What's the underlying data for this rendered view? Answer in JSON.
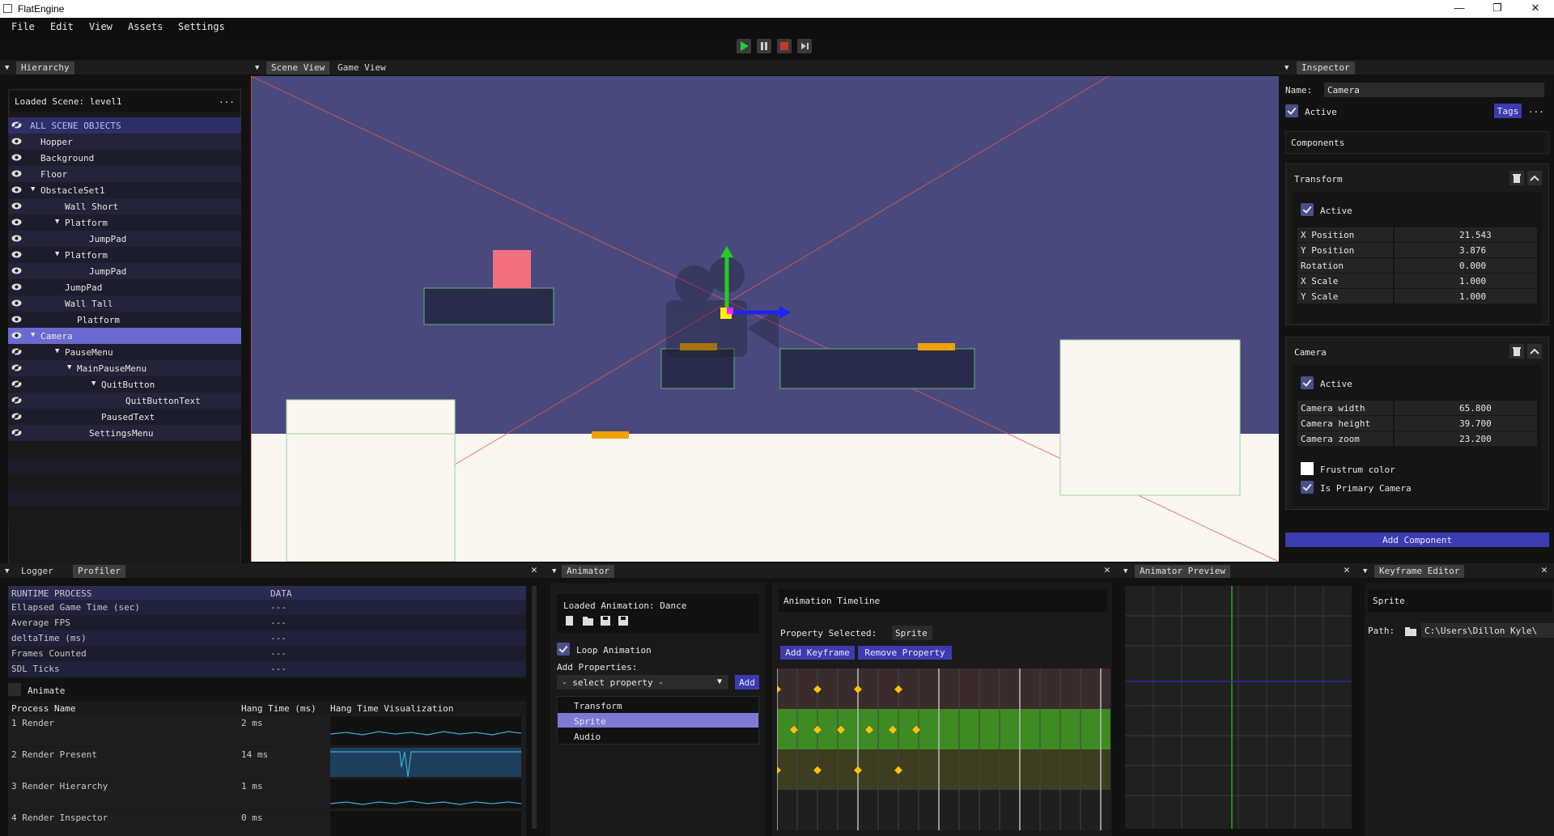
{
  "window": {
    "title": "FlatEngine",
    "minimize": "—",
    "restore": "❐",
    "close": "✕"
  },
  "menu": [
    "File",
    "Edit",
    "View",
    "Assets",
    "Settings"
  ],
  "hierarchy": {
    "tab": "Hierarchy",
    "loaded_scene": "Loaded Scene: level1",
    "more": "...",
    "all_objects": "ALL SCENE OBJECTS",
    "items": [
      {
        "label": "Hopper",
        "indent": 0,
        "arrow": ""
      },
      {
        "label": "Background",
        "indent": 0,
        "arrow": ""
      },
      {
        "label": "Floor",
        "indent": 0,
        "arrow": ""
      },
      {
        "label": "ObstacleSet1",
        "indent": 0,
        "arrow": "▼"
      },
      {
        "label": "Wall Short",
        "indent": 2,
        "arrow": ""
      },
      {
        "label": "Platform",
        "indent": 2,
        "arrow": "▼"
      },
      {
        "label": "JumpPad",
        "indent": 4,
        "arrow": ""
      },
      {
        "label": "Platform",
        "indent": 2,
        "arrow": "▼"
      },
      {
        "label": "JumpPad",
        "indent": 4,
        "arrow": ""
      },
      {
        "label": "JumpPad",
        "indent": 2,
        "arrow": ""
      },
      {
        "label": "Wall Tall",
        "indent": 2,
        "arrow": ""
      },
      {
        "label": "Platform",
        "indent": 3,
        "arrow": ""
      },
      {
        "label": "Camera",
        "indent": 0,
        "arrow": "▼"
      },
      {
        "label": "PauseMenu",
        "indent": 2,
        "arrow": "▼"
      },
      {
        "label": "MainPauseMenu",
        "indent": 3,
        "arrow": "▼"
      },
      {
        "label": "QuitButton",
        "indent": 5,
        "arrow": "▼"
      },
      {
        "label": "QuitButtonText",
        "indent": 7,
        "arrow": ""
      },
      {
        "label": "PausedText",
        "indent": 5,
        "arrow": ""
      },
      {
        "label": "SettingsMenu",
        "indent": 4,
        "arrow": ""
      }
    ]
  },
  "scene_tabs": [
    "Scene View",
    "Game View"
  ],
  "inspector": {
    "tab": "Inspector",
    "name_label": "Name:",
    "name_value": "Camera",
    "active": "Active",
    "tags": "Tags",
    "more": "...",
    "components": "Components",
    "transform": {
      "title": "Transform",
      "active": "Active",
      "rows": [
        {
          "label": "X Position",
          "value": "21.543"
        },
        {
          "label": "Y Position",
          "value": "3.876"
        },
        {
          "label": "Rotation",
          "value": "0.000"
        },
        {
          "label": "X Scale",
          "value": "1.000"
        },
        {
          "label": "Y Scale",
          "value": "1.000"
        }
      ]
    },
    "camera": {
      "title": "Camera",
      "active": "Active",
      "rows": [
        {
          "label": "Camera width",
          "value": "65.800"
        },
        {
          "label": "Camera height",
          "value": "39.700"
        },
        {
          "label": "Camera zoom",
          "value": "23.200"
        }
      ],
      "frustrum": "Frustrum color",
      "primary": "Is Primary Camera"
    },
    "add_component": "Add Component"
  },
  "logger": {
    "tabs": [
      "Logger",
      "Profiler"
    ],
    "close": "✕",
    "headers": [
      "RUNTIME PROCESS",
      "DATA"
    ],
    "rows": [
      {
        "label": "Ellapsed Game Time (sec)",
        "value": "---"
      },
      {
        "label": "Average FPS",
        "value": "---"
      },
      {
        "label": "deltaTime (ms)",
        "value": "---"
      },
      {
        "label": "Frames Counted",
        "value": "---"
      },
      {
        "label": "SDL Ticks",
        "value": "---"
      }
    ],
    "animate": "Animate",
    "proc_headers": [
      "Process Name",
      "Hang Time (ms)",
      "Hang Time Visualization"
    ],
    "processes": [
      {
        "name": "1 Render",
        "time": "2 ms"
      },
      {
        "name": "2 Render Present",
        "time": "14 ms"
      },
      {
        "name": "3 Render Hierarchy",
        "time": "1 ms"
      },
      {
        "name": "4 Render Inspector",
        "time": "0 ms"
      }
    ]
  },
  "animator": {
    "tab": "Animator",
    "close": "✕",
    "loaded": "Loaded Animation: Dance",
    "loop": "Loop Animation",
    "add_props": "Add Properties:",
    "select_placeholder": "- select property -",
    "add": "Add",
    "properties": [
      "Transform",
      "Sprite",
      "Audio"
    ],
    "timeline_title": "Animation Timeline",
    "property_selected_label": "Property Selected:",
    "property_selected": "Sprite",
    "add_keyframe": "Add Keyframe",
    "remove_property": "Remove Property"
  },
  "preview": {
    "tab": "Animator Preview",
    "close": "✕"
  },
  "keyframe_editor": {
    "tab": "Keyframe Editor",
    "close": "✕",
    "title": "Sprite",
    "path_label": "Path:",
    "path_value": "C:\\Users\\Dillon Kyle\\"
  }
}
